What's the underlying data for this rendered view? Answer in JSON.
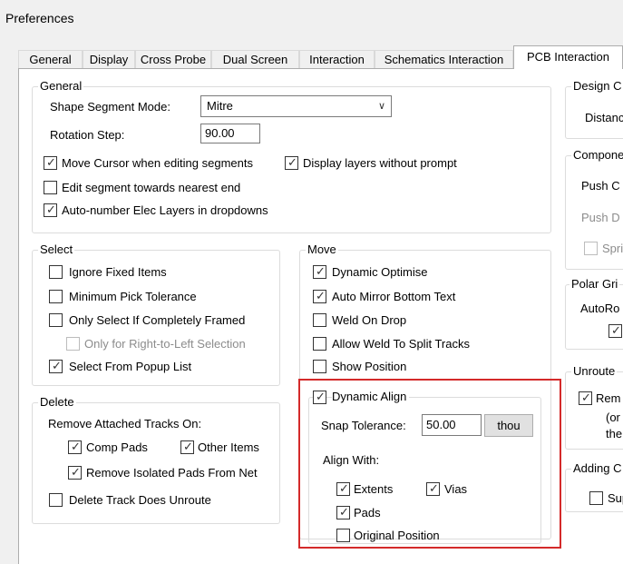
{
  "window": {
    "title": "Preferences"
  },
  "tabs": [
    {
      "label": "General"
    },
    {
      "label": "Display"
    },
    {
      "label": "Cross Probe"
    },
    {
      "label": "Dual Screen"
    },
    {
      "label": "Interaction"
    },
    {
      "label": "Schematics Interaction"
    },
    {
      "label": "PCB Interaction"
    }
  ],
  "general": {
    "legend": "General",
    "shape_segment_mode_label": "Shape Segment Mode:",
    "shape_segment_mode_value": "Mitre",
    "rotation_step_label": "Rotation Step:",
    "rotation_step_value": "90.00",
    "move_cursor": "Move Cursor when editing segments",
    "display_layers": "Display layers without prompt",
    "edit_segment": "Edit segment towards nearest end",
    "auto_number": "Auto-number Elec Layers in dropdowns"
  },
  "select": {
    "legend": "Select",
    "ignore_fixed": "Ignore Fixed Items",
    "min_pick": "Minimum Pick Tolerance",
    "only_framed": "Only Select If Completely Framed",
    "right_to_left": "Only for Right-to-Left Selection",
    "popup_list": "Select From Popup List"
  },
  "delete": {
    "legend": "Delete",
    "remove_attached": "Remove Attached Tracks On:",
    "comp_pads": "Comp Pads",
    "other_items": "Other Items",
    "remove_isolated": "Remove Isolated Pads From Net",
    "delete_track": "Delete Track Does Unroute"
  },
  "move": {
    "legend": "Move",
    "dynamic_optimise": "Dynamic Optimise",
    "auto_mirror": "Auto Mirror Bottom Text",
    "weld_on_drop": "Weld On Drop",
    "allow_weld": "Allow Weld To Split Tracks",
    "show_position": "Show Position"
  },
  "dynamic_align": {
    "legend": "Dynamic Align",
    "snap_label": "Snap Tolerance:",
    "snap_value": "50.00",
    "unit_button": "thou",
    "align_with": "Align With:",
    "extents": "Extents",
    "vias": "Vias",
    "pads": "Pads",
    "original_position": "Original Position"
  },
  "right_col": {
    "design_legend": "Design C",
    "distance": "Distanc",
    "component_legend": "Compone",
    "push_c": "Push C",
    "push_d": "Push D",
    "spri": "Spri",
    "polar_legend": "Polar Gri",
    "auto_ro": "AutoRo",
    "unroute_legend": "Unroute",
    "rem": "Rem",
    "or": "(or",
    "the": "the",
    "adding_legend": "Adding C",
    "sup": "Sup"
  }
}
